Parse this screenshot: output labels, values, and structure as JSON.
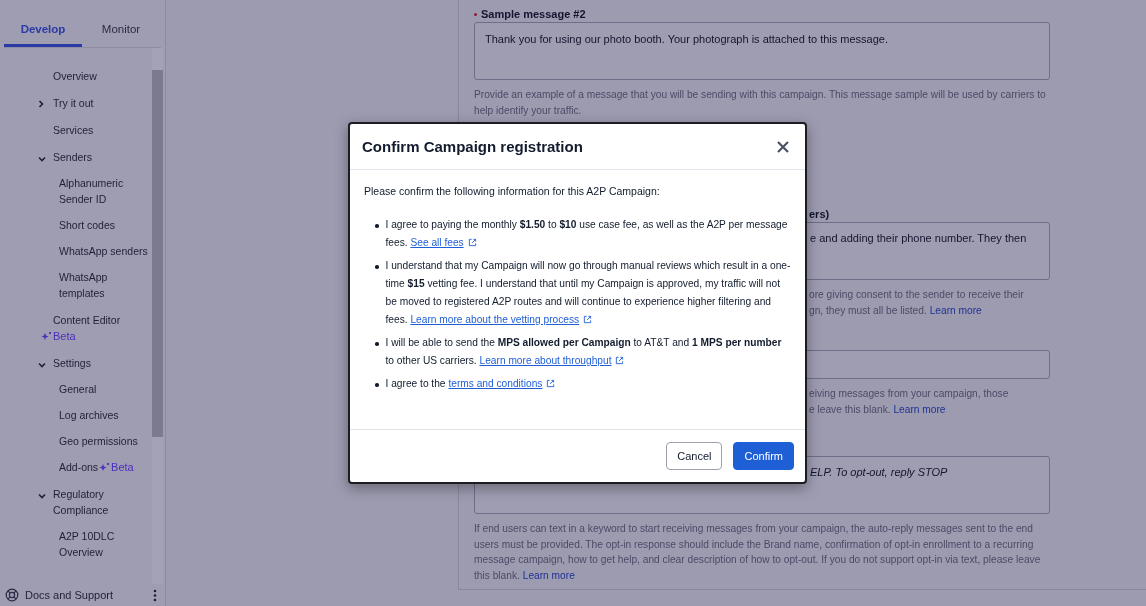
{
  "sidebar": {
    "tabs": [
      {
        "label": "Develop",
        "selected": true
      },
      {
        "label": "Monitor",
        "selected": false
      }
    ],
    "items": [
      {
        "label": "Overview"
      },
      {
        "label": "Try it out",
        "expanded": false
      },
      {
        "label": "Services"
      },
      {
        "label": "Senders",
        "expanded": true,
        "children": [
          {
            "label": "Alphanumeric Sender ID"
          },
          {
            "label": "Short codes"
          },
          {
            "label": "WhatsApp senders"
          },
          {
            "label": "WhatsApp templates"
          }
        ]
      },
      {
        "label": "Content Editor",
        "badge": "Beta"
      },
      {
        "label": "Settings",
        "expanded": true,
        "children": [
          {
            "label": "General"
          },
          {
            "label": "Log archives"
          },
          {
            "label": "Geo permissions"
          },
          {
            "label": "Add-ons",
            "badge": "Beta"
          }
        ]
      },
      {
        "label": "Regulatory Compliance",
        "expanded": true,
        "children": [
          {
            "label": "A2P 10DLC Overview"
          }
        ]
      }
    ],
    "footer": "Docs and Support"
  },
  "form": {
    "fields": [
      {
        "kind": "textarea",
        "label": "Sample message #2",
        "required": true,
        "value": "Thank you for using our photo booth. Your photograph is attached to this message.",
        "help": [
          "Provide an example of a message that you will be sending with this campaign. This message sample will be used by carriers to help identify your traffic."
        ]
      },
      {
        "kind": "textarea",
        "label": "ers)",
        "value": "e and adding their phone number. They then",
        "help": [
          "ore giving consent to the sender to receive their",
          "gn, they must all be listed."
        ],
        "link": "Learn more"
      },
      {
        "kind": "input",
        "help": [
          "eiving messages from your campaign, those",
          "e leave this blank."
        ],
        "link": "Learn more"
      },
      {
        "kind": "textarea",
        "placeholder": "ELP. To opt-out, reply STOP"
      },
      {
        "kind": "note",
        "help": [
          "If end users can text in a keyword to start receiving messages from your campaign, the auto-reply messages sent to the end users must be provided. The opt-in response should include the Brand name, confirmation of opt-in enrollment to a recurring message campaign, how to get help, and clear description of how to opt-out. If you do not support opt-in via text, please leave this blank."
        ],
        "link": "Learn more"
      }
    ]
  },
  "dialog": {
    "title": "Confirm Campaign registration",
    "intro": "Please confirm the following information for this A2P Campaign:",
    "items": [
      {
        "text": "I agree to paying the monthly **$1.50** to **$10** use case fee, as well as the A2P per message fees.",
        "link": "See all fees"
      },
      {
        "text": "I understand that my Campaign will now go through manual reviews which result in a one-time **$15** vetting fee. I understand that until my Campaign is approved, my traffic will not be moved to registered A2P routes and will continue to experience higher filtering and fees.",
        "link": "Learn more about the vetting process"
      },
      {
        "text": "I will be able to send the **MPS allowed per Campaign** to AT&T and **1 MPS per number** to other US carriers.",
        "link": "Learn more about throughput"
      },
      {
        "text": "I agree to the",
        "link": "terms and conditions"
      }
    ],
    "buttons": [
      {
        "label": "Cancel",
        "kind": "secondary"
      },
      {
        "label": "Confirm",
        "kind": "primary"
      }
    ]
  }
}
